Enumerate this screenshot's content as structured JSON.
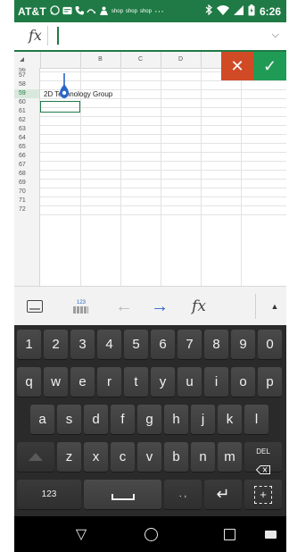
{
  "status_bar": {
    "carrier": "AT&T",
    "time": "6:26",
    "icons": [
      "whatsapp-icon",
      "messages-icon",
      "phone-icon",
      "nfc-icon",
      "nfc-icon",
      "shop-icon",
      "shop-icon",
      "shop-icon",
      "more-icon",
      "bluetooth-icon",
      "wifi-icon",
      "signal-icon",
      "battery-icon"
    ],
    "shop_labels": [
      "shop",
      "shop",
      "shop"
    ],
    "more": "···"
  },
  "formula_bar": {
    "fx_label": "fx",
    "value": "",
    "chevron": "⌵"
  },
  "sheet": {
    "columns": [
      "B",
      "C",
      "D"
    ],
    "rows": [
      "56",
      "57",
      "58",
      "59",
      "60",
      "61",
      "62",
      "63",
      "64",
      "65",
      "66",
      "67",
      "68",
      "69",
      "70",
      "71",
      "72"
    ],
    "selected_row": "59",
    "cells": {
      "A58": "2D Technology Group"
    },
    "active_cell": "A59",
    "cancel_label": "✕",
    "accept_label": "✓",
    "colors": {
      "accent": "#1f7a45",
      "cancel": "#d04a25",
      "accept": "#1f9b55"
    }
  },
  "toolbar": {
    "num_label": "123",
    "left_arrow": "←",
    "right_arrow": "→",
    "fx_label": "fx",
    "up_arrow": "▲"
  },
  "keyboard": {
    "row1": [
      "1",
      "2",
      "3",
      "4",
      "5",
      "6",
      "7",
      "8",
      "9",
      "0"
    ],
    "row2": [
      "q",
      "w",
      "e",
      "r",
      "t",
      "y",
      "u",
      "i",
      "o",
      "p"
    ],
    "row3": [
      "a",
      "s",
      "d",
      "f",
      "g",
      "h",
      "j",
      "k",
      "l"
    ],
    "row4": [
      "z",
      "x",
      "c",
      "v",
      "b",
      "n",
      "m"
    ],
    "del_label": "DEL",
    "numbers_label": "123",
    "punct_label": ". ,",
    "enter_label": "↵",
    "bracket_label": "+"
  },
  "nav": {
    "back": "▽",
    "home": "home",
    "recent": "recent",
    "keyboard": "keyboard"
  }
}
